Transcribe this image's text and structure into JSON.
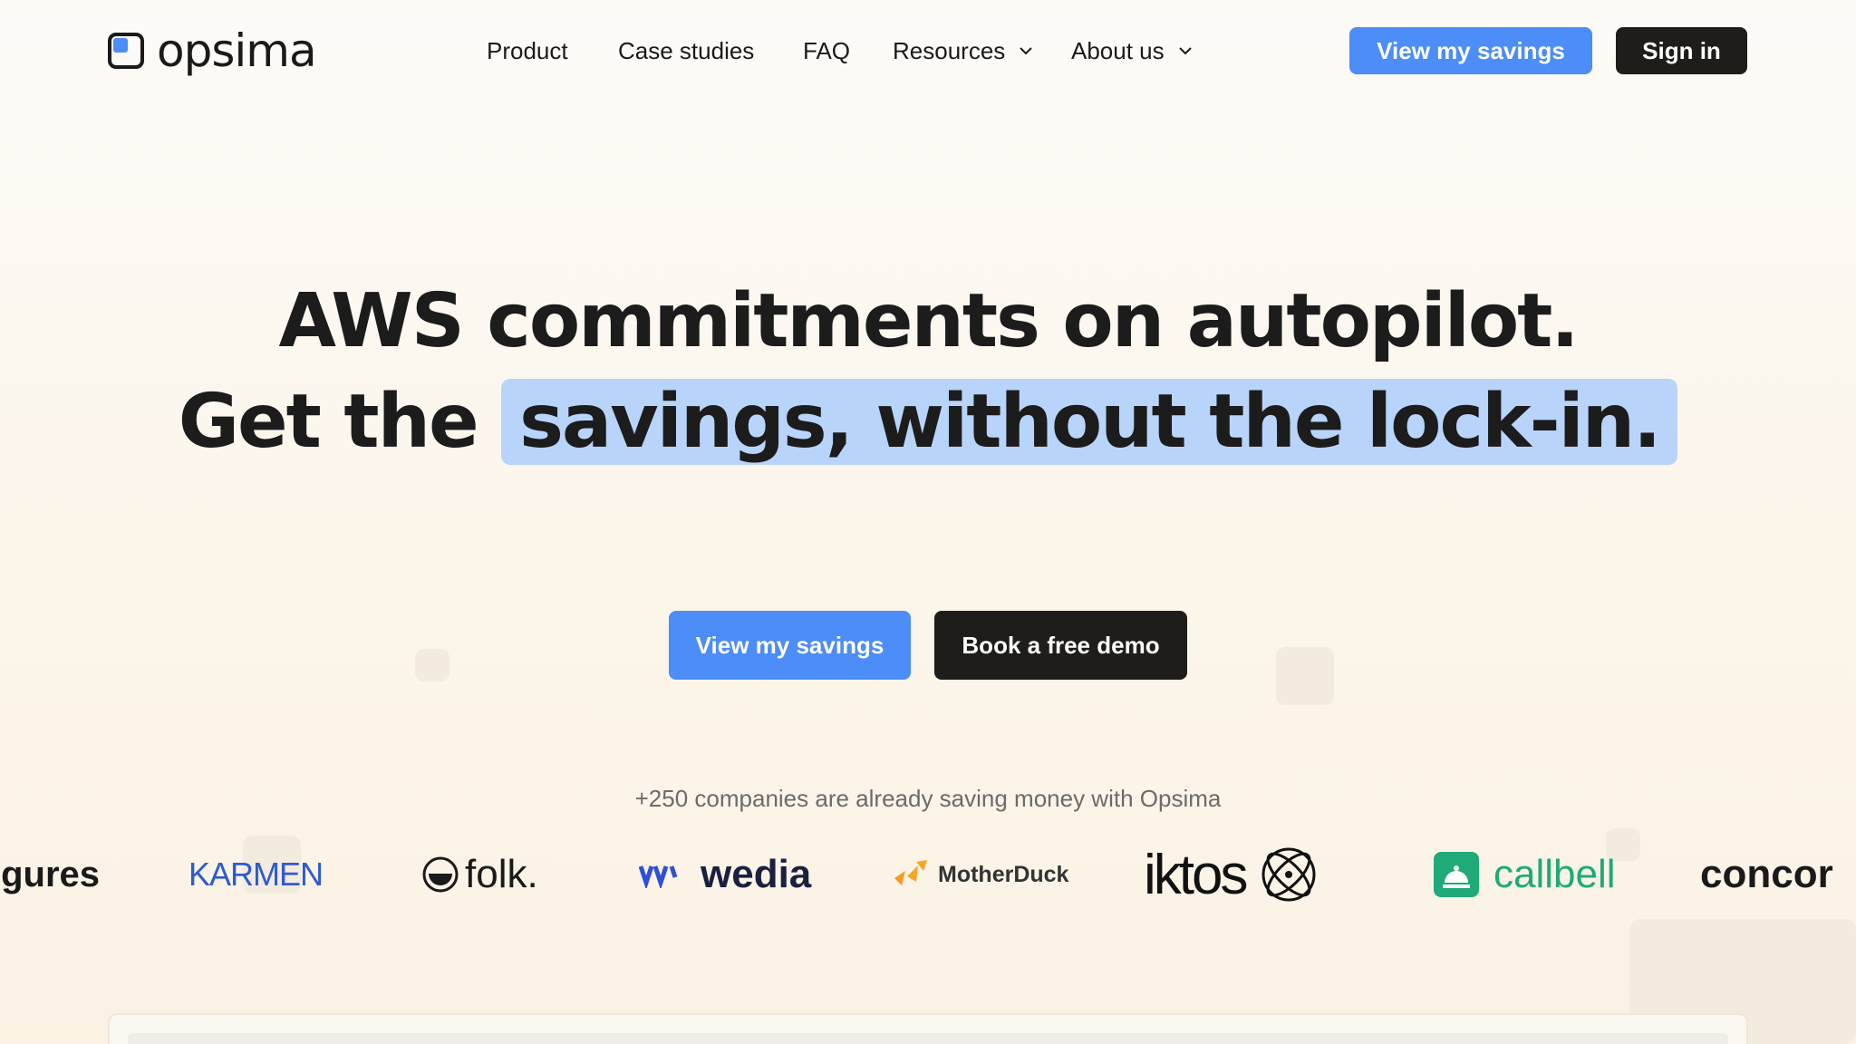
{
  "brand": {
    "name": "opsima",
    "accent": "#4c8df7",
    "dark": "#1f1d1a"
  },
  "nav": {
    "items": [
      {
        "label": "Product"
      },
      {
        "label": "Case studies"
      },
      {
        "label": "FAQ"
      },
      {
        "label": "Resources",
        "dropdown": true
      },
      {
        "label": "About us",
        "dropdown": true
      }
    ],
    "cta_label": "View my savings",
    "signin_label": "Sign in"
  },
  "hero": {
    "line1": "AWS commitments on autopilot.",
    "line2_prefix": "Get the",
    "line2_highlight": "savings, without the lock-in.",
    "primary_cta": "View my savings",
    "secondary_cta": "Book a free demo"
  },
  "social_proof": {
    "tagline": "+250 companies are already saving money with Opsima",
    "logos": [
      "igures",
      "KARMEN",
      "folk.",
      "wedia",
      "MotherDuck",
      "iktos",
      "callbell",
      "concor"
    ]
  }
}
